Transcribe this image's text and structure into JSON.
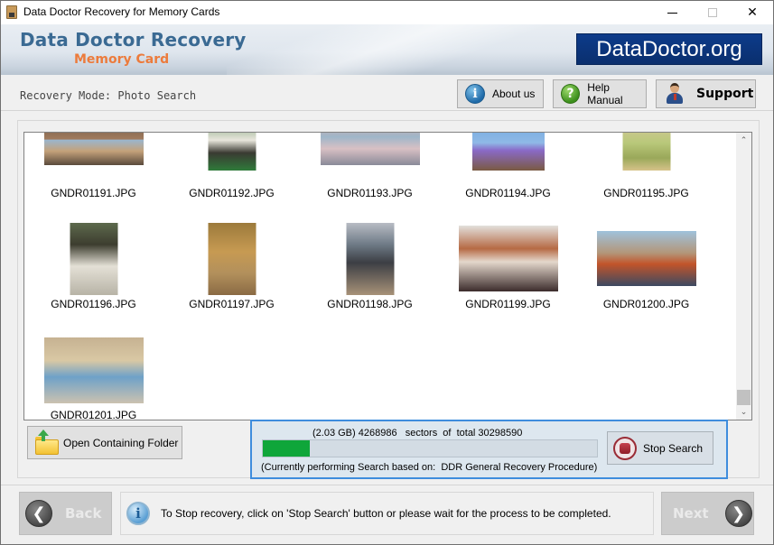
{
  "window": {
    "title": "Data Doctor Recovery for Memory Cards",
    "controls": {
      "minimize": "minimize",
      "maximize": "maximize",
      "close": "✕"
    }
  },
  "banner": {
    "brand_main": "Data Doctor Recovery",
    "brand_sub": "Memory Card",
    "logo_text": "DataDoctor.org"
  },
  "toolbar": {
    "mode_label": "Recovery Mode: Photo Search",
    "about_label": "About us",
    "about_icon_glyph": "i",
    "help_label": "Help Manual",
    "help_icon_glyph": "?",
    "support_label": "Support"
  },
  "gallery": {
    "items": [
      {
        "name": "GNDR01191.JPG"
      },
      {
        "name": "GNDR01192.JPG"
      },
      {
        "name": "GNDR01193.JPG"
      },
      {
        "name": "GNDR01194.JPG"
      },
      {
        "name": "GNDR01195.JPG"
      },
      {
        "name": "GNDR01196.JPG"
      },
      {
        "name": "GNDR01197.JPG"
      },
      {
        "name": "GNDR01198.JPG"
      },
      {
        "name": "GNDR01199.JPG"
      },
      {
        "name": "GNDR01200.JPG"
      },
      {
        "name": "GNDR01201.JPG"
      }
    ],
    "scroll_up_glyph": "⌃",
    "scroll_down_glyph": "⌄"
  },
  "actions": {
    "open_folder_label": "Open Containing Folder"
  },
  "progress": {
    "size_text": "(2.03 GB) 4268986   sectors  of  total 30298590",
    "sectors_done": 4268986,
    "sectors_total": 30298590,
    "fraction": 0.1409,
    "procedure_text": "(Currently performing Search based on:  DDR General Recovery Procedure)",
    "stop_label": "Stop Search",
    "fill_color": "#0fa63a"
  },
  "footer": {
    "back_label": "Back",
    "next_label": "Next",
    "status_text": "To Stop recovery, click on 'Stop Search' button or please wait for the process to be completed.",
    "info_glyph": "i",
    "back_glyph": "❮",
    "next_glyph": "❯"
  }
}
